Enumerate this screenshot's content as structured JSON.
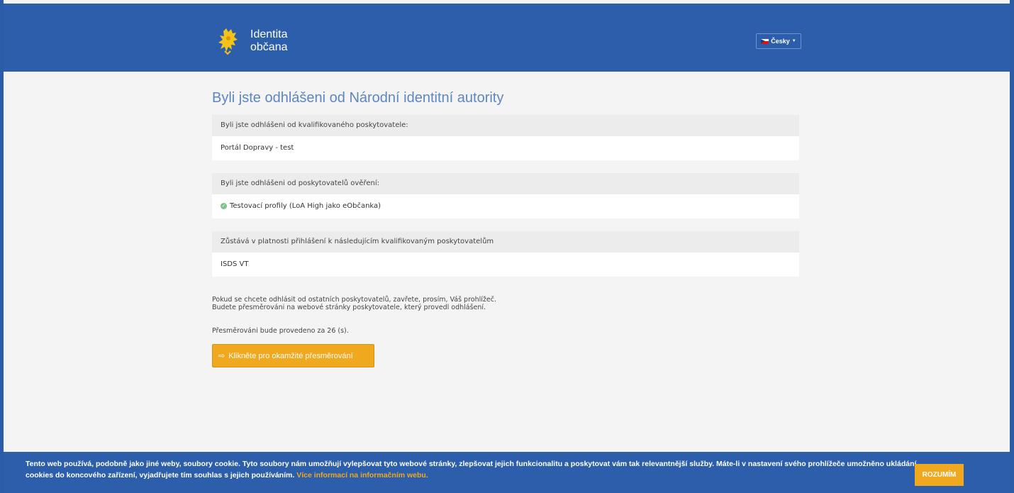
{
  "header": {
    "logo_line1": "Identita",
    "logo_line2": "občana",
    "language": "Česky"
  },
  "main": {
    "title": "Byli jste odhlášeni od Národní identitní autority",
    "panel1": {
      "head": "Byli jste odhlášeni od kvalifikovaného poskytovatele:",
      "body": "Portál Dopravy - test"
    },
    "panel2": {
      "head": "Byli jste odhlášeni od poskytovatelů ověření:",
      "body": "Testovací profily (LoA High jako eObčanka)"
    },
    "panel3": {
      "head": "Zůstává v platnosti přihlášení k následujícím kvalifikovaným poskytovatelům",
      "body": "ISDS VT"
    },
    "info_line1": "Pokud se chcete odhlásit od ostatních poskytovatelů, zavřete, prosím, Váš prohlížeč.",
    "info_line2": "Budete přesměrováni na webové stránky poskytovatele, který provedl odhlášení.",
    "countdown": "Přesměrováni bude provedeno za 26 (s).",
    "redirect_button": "Klikněte pro okamžité přesměrování"
  },
  "cookie_bar": {
    "text": "Tento web používá, podobně jako jiné weby, soubory cookie. Tyto soubory nám umožňují vylepšovat tyto webové stránky, zlepšovat jejich funkcionalitu a poskytovat vám tak relevantnější služby. Máte-li v nastavení svého prohlížeče umožněno ukládání cookies do koncového zařízení, vyjadřujete tím souhlas s jejich používáním.",
    "link": "Více informací na informačním webu.",
    "accept_button": "ROZUMÍM"
  },
  "colors": {
    "brand_blue": "#2c5eab",
    "accent_orange": "#f0a91e",
    "title_blue": "#5e86bf"
  },
  "icons": {
    "logo": "heraldic-lion-icon",
    "language": "czech-flag-icon",
    "status": "check-circle-icon",
    "redirect": "sign-out-icon"
  }
}
